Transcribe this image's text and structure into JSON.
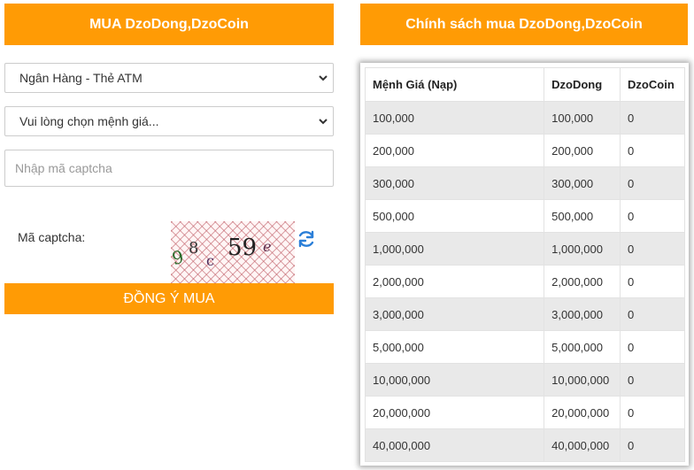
{
  "buy_header": "MUA DzoDong,DzoCoin",
  "policy_header": "Chính sách mua DzoDong,DzoCoin",
  "payment_select": {
    "value": "Ngân Hàng - Thẻ ATM"
  },
  "amount_select": {
    "value": "Vui lòng chọn mệnh giá..."
  },
  "captcha_input": {
    "placeholder": "Nhập mã captcha"
  },
  "captcha_label": "Mã captcha:",
  "captcha_text": [
    "9",
    "8",
    "c",
    "59",
    "e"
  ],
  "buy_button": "ĐỒNG Ý MUA",
  "accent_color": "#ff9b05",
  "table": {
    "headers": [
      "Mệnh Giá (Nạp)",
      "DzoDong",
      "DzoCoin"
    ],
    "rows": [
      [
        "100,000",
        "100,000",
        "0"
      ],
      [
        "200,000",
        "200,000",
        "0"
      ],
      [
        "300,000",
        "300,000",
        "0"
      ],
      [
        "500,000",
        "500,000",
        "0"
      ],
      [
        "1,000,000",
        "1,000,000",
        "0"
      ],
      [
        "2,000,000",
        "2,000,000",
        "0"
      ],
      [
        "3,000,000",
        "3,000,000",
        "0"
      ],
      [
        "5,000,000",
        "5,000,000",
        "0"
      ],
      [
        "10,000,000",
        "10,000,000",
        "0"
      ],
      [
        "20,000,000",
        "20,000,000",
        "0"
      ],
      [
        "40,000,000",
        "40,000,000",
        "0"
      ]
    ]
  }
}
